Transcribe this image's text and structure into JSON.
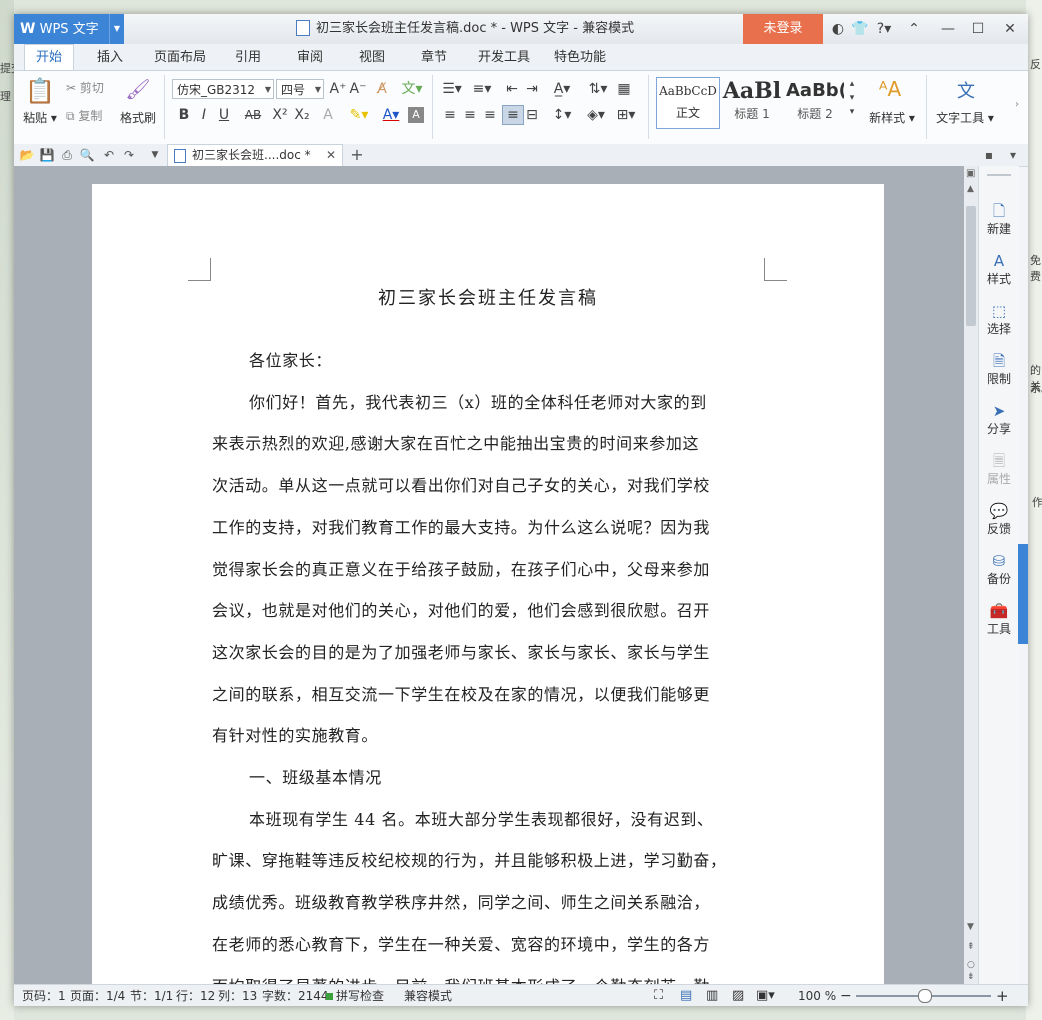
{
  "background": {
    "left_labels": [
      "提交下",
      "理"
    ],
    "right_labels": [
      "反",
      "免费",
      "的关",
      "系。",
      "作"
    ]
  },
  "titlebar": {
    "app_name": "WPS 文字",
    "title": "初三家长会班主任发言稿.doc * - WPS 文字 - 兼容模式",
    "login_label": "未登录"
  },
  "ribbon_tabs": [
    "开始",
    "插入",
    "页面布局",
    "引用",
    "审阅",
    "视图",
    "章节",
    "开发工具",
    "特色功能"
  ],
  "ribbon": {
    "paste": "粘贴",
    "cut": "剪切",
    "copy": "复制",
    "format_painter": "格式刷",
    "font_name": "仿宋_GB2312",
    "font_size": "四号",
    "styles": [
      {
        "preview": "AaBbCcD",
        "label": "正文"
      },
      {
        "preview": "AaBl",
        "label": "标题 1"
      },
      {
        "preview": "AaBb(",
        "label": "标题 2"
      }
    ],
    "new_style": "新样式",
    "text_tools": "文字工具"
  },
  "doc_tab": {
    "label": "初三家长会班....doc *"
  },
  "document": {
    "title": "初三家长会班主任发言稿",
    "lines": [
      "各位家长：",
      "你们好！首先，我代表初三（x）班的全体科任老师对大家的到",
      "来表示热烈的欢迎,感谢大家在百忙之中能抽出宝贵的时间来参加这",
      "次活动。单从这一点就可以看出你们对自己子女的关心，对我们学校",
      "工作的支持，对我们教育工作的最大支持。为什么这么说呢？因为我",
      "觉得家长会的真正意义在于给孩子鼓励，在孩子们心中，父母来参加",
      "会议，也就是对他们的关心，对他们的爱，他们会感到很欣慰。召开",
      "这次家长会的目的是为了加强老师与家长、家长与家长、家长与学生",
      "之间的联系，相互交流一下学生在校及在家的情况，以便我们能够更",
      "有针对性的实施教育。",
      "一、班级基本情况",
      "本班现有学生 44 名。本班大部分学生表现都很好，没有迟到、",
      "旷课、穿拖鞋等违反校纪校规的行为，并且能够积极上进，学习勤奋，",
      "成绩优秀。班级教育教学秩序井然，同学之间、师生之间关系融洽，",
      "在老师的悉心教育下，学生在一种关爱、宽容的环境中，学生的各方",
      "面均取得了显著的进步。目前，我们班基本形成了一个勤奋刻苦、勤"
    ]
  },
  "side_panel": [
    "新建",
    "样式",
    "选择",
    "限制",
    "分享",
    "属性",
    "反馈",
    "备份",
    "工具"
  ],
  "statusbar": {
    "page": "页码：1",
    "pages": "页面：1/4",
    "section": "节：1/1",
    "row": "行：12",
    "col": "列：13",
    "wordcount": "字数：2144",
    "spellcheck": "拼写检查",
    "compat": "兼容模式",
    "zoom": "100 %"
  }
}
